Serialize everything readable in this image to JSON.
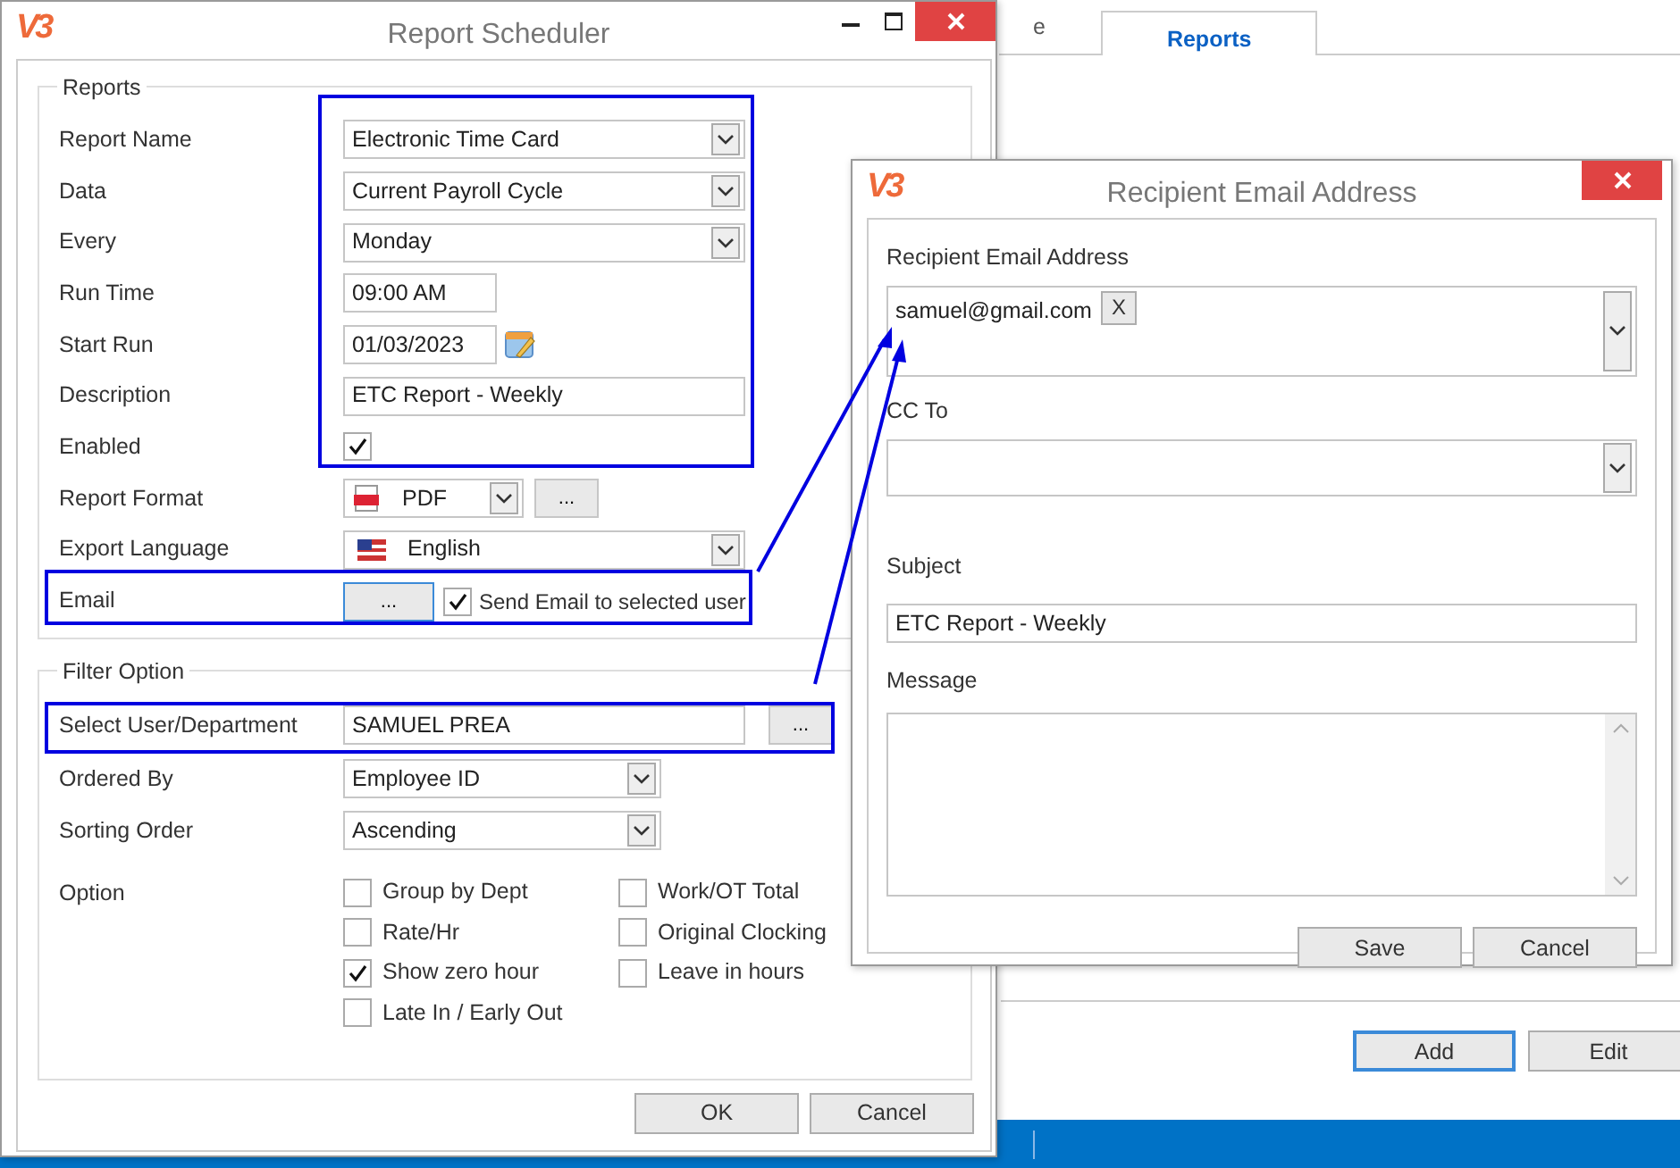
{
  "background": {
    "tabs": [
      {
        "label": "e",
        "selected": false
      },
      {
        "label": "Reports",
        "selected": true
      }
    ],
    "buttons": [
      {
        "label": "Add",
        "default": true
      },
      {
        "label": "Edit",
        "default": false
      }
    ]
  },
  "scheduler": {
    "logo": "V3",
    "title": "Report Scheduler",
    "groups": [
      {
        "title": "Reports",
        "rows": [
          {
            "label": "Report Name",
            "kind": "combo",
            "value": "Electronic Time Card"
          },
          {
            "label": "Data",
            "kind": "combo",
            "value": "Current Payroll Cycle"
          },
          {
            "label": "Every",
            "kind": "combo",
            "value": "Monday"
          },
          {
            "label": "Run Time",
            "kind": "time",
            "value": "09:00 AM"
          },
          {
            "label": "Start Run",
            "kind": "date",
            "value": "01/03/2023"
          },
          {
            "label": "Description",
            "kind": "text",
            "value": "ETC Report - Weekly"
          },
          {
            "label": "Enabled",
            "kind": "checkbox",
            "checked": true
          },
          {
            "label": "Report Format",
            "kind": "format",
            "value": "PDF",
            "button": "..."
          },
          {
            "label": "Export Language",
            "kind": "language",
            "value": "English"
          },
          {
            "label": "Email",
            "kind": "email",
            "button": "...",
            "option": {
              "label": "Send Email to selected user",
              "checked": true
            }
          }
        ]
      },
      {
        "title": "Filter Option",
        "rows": [
          {
            "label": "Select User/Department",
            "kind": "picker",
            "value": "SAMUEL PREA",
            "button": "..."
          },
          {
            "label": "Ordered By",
            "kind": "combo",
            "value": "Employee ID"
          },
          {
            "label": "Sorting Order",
            "kind": "combo",
            "value": "Ascending"
          },
          {
            "label": "Option",
            "kind": "options",
            "columns": [
              [
                {
                  "label": "Group by Dept",
                  "checked": false
                },
                {
                  "label": "Rate/Hr",
                  "checked": false
                },
                {
                  "label": "Show zero hour",
                  "checked": true
                },
                {
                  "label": "Late In / Early Out",
                  "checked": false
                }
              ],
              [
                {
                  "label": "Work/OT Total",
                  "checked": false
                },
                {
                  "label": "Original Clocking",
                  "checked": false
                },
                {
                  "label": "Leave in hours",
                  "checked": false
                }
              ]
            ]
          }
        ]
      }
    ],
    "buttons": [
      "OK",
      "Cancel"
    ]
  },
  "recipient_dialog": {
    "logo": "V3",
    "title": "Recipient Email Address",
    "recipient_label": "Recipient Email Address",
    "recipients": [
      {
        "address": "samuel@gmail.com",
        "remove": "X"
      }
    ],
    "cc_label": "CC To",
    "subject_label": "Subject",
    "subject": "ETC Report - Weekly",
    "message_label": "Message",
    "buttons": [
      "Save",
      "Cancel"
    ]
  }
}
